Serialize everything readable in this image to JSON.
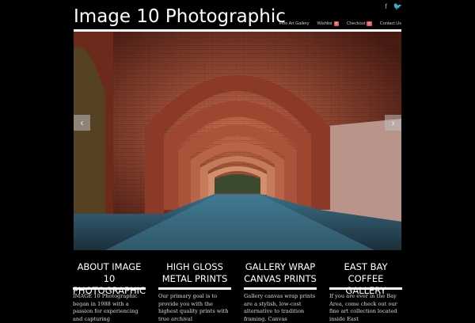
{
  "site": {
    "title": "Image 10 Photographic"
  },
  "social": {
    "facebook": "f",
    "twitter": "🐦"
  },
  "nav": {
    "items": [
      {
        "label": "Fine Art Gallery",
        "badge": ""
      },
      {
        "label": "Wishlist",
        "badge": "0"
      },
      {
        "label": "Checkout",
        "badge": "0"
      },
      {
        "label": "Contact Us",
        "badge": ""
      }
    ]
  },
  "slider": {
    "prev": "‹",
    "next": "›"
  },
  "columns": [
    {
      "heading": "ABOUT IMAGE 10 PHOTOGRAPHIC",
      "text": "IMAGE 10 Photographic began in 1988 with a passion for experiencing and capturing"
    },
    {
      "heading": "HIGH GLOSS METAL PRINTS",
      "text": "Our primary goal is to provide you with the highest quality prints with true archival"
    },
    {
      "heading": "GALLERY WRAP CANVAS PRINTS",
      "text": "Gallery canvas wrap prints are a stylish, low-cost alternative to tradition framing. Canvas"
    },
    {
      "heading": "EAST BAY COFFEE GALLERY",
      "text": "If you are ever in the Bay Area, come check out our fine art collection located inside East"
    }
  ],
  "colors": {
    "accent": "#e05a5a",
    "background": "#000000"
  }
}
